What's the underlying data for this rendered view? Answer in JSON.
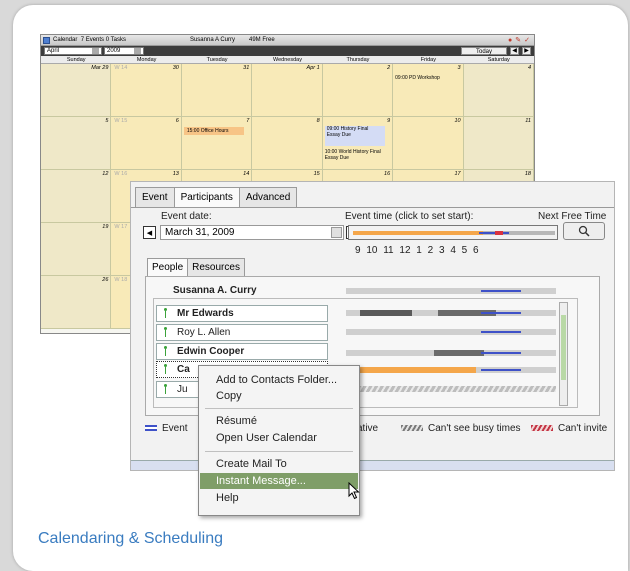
{
  "caption": "Calendaring & Scheduling",
  "calendar": {
    "title": "Calendar",
    "events_count": "7 Events",
    "tasks_count": "0 Tasks",
    "user": "Susanna A Curry",
    "free_space": "49M Free",
    "month": "April",
    "year": "2009",
    "today_label": "Today",
    "weekdays": [
      "Sunday",
      "Monday",
      "Tuesday",
      "Wednesday",
      "Thursday",
      "Friday",
      "Saturday"
    ],
    "row1": [
      "Mar 29",
      "30",
      "31",
      "Apr 1",
      "2",
      "3",
      "4"
    ],
    "row2": [
      "5",
      "6",
      "7",
      "8",
      "9",
      "10",
      "11"
    ],
    "row3": [
      "12",
      "13",
      "14",
      "15",
      "16",
      "17",
      "18"
    ],
    "week_labels": [
      "W 14",
      "W 15",
      "W 16",
      "W 17",
      "W 18"
    ],
    "row4_first": "19",
    "row5_first": "26",
    "events": {
      "pd_workshop": "09:00 PD Workshop",
      "office_hours": "15:00 Office Hours",
      "history_essay": "09:00 History Final Essay Due",
      "world_history": "10:00 World History Final Essay Due"
    }
  },
  "dialog": {
    "tabs": [
      "Event",
      "Participants",
      "Advanced"
    ],
    "event_date_label": "Event date:",
    "event_date": "March 31, 2009",
    "event_time_label": "Event time (click to set start):",
    "next_free_label": "Next Free Time",
    "hour_ticks": "9 10 11 12 1 2 3 4 5 6",
    "subtabs": [
      "People",
      "Resources"
    ],
    "organizer": "Susanna A. Curry",
    "people": [
      "Mr Edwards",
      "Roy L. Allen",
      "Edwin Cooper",
      "Ca",
      "Ju"
    ],
    "legend": {
      "event": "Event",
      "tentative": "ative",
      "cant_see": "Can't see busy times",
      "cant_invite": "Can't invite"
    }
  },
  "context_menu": {
    "items": [
      "Add to Contacts Folder...",
      "Copy",
      "Résumé",
      "Open User Calendar",
      "Create Mail To",
      "Instant Message...",
      "Help"
    ],
    "highlighted": "Instant Message..."
  },
  "colors": {
    "caption": "#3a7cc0",
    "busy_orange": "#f4a64a",
    "event_blue": "#3e51c8",
    "highlight_green": "#7f9e68"
  }
}
